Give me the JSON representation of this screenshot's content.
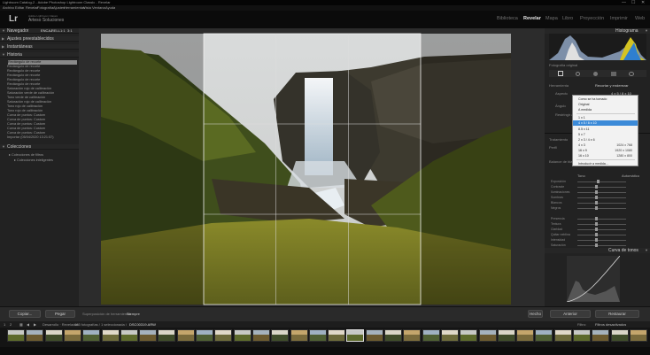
{
  "window": {
    "title": "Lightroom Catalog-2 - Adobe Photoshop Lightroom Classic - Revelar",
    "controls": [
      "—",
      "☐",
      "✕"
    ]
  },
  "menu": [
    "Archivo",
    "Editar",
    "Revelar",
    "Fotografía",
    "Ajustes",
    "Herramientas",
    "Vista",
    "Ventana",
    "Ayuda"
  ],
  "identity": {
    "logo": "Lr",
    "catalog": "Adobe Lightroom Classic",
    "name": "Arteso Soluciones"
  },
  "modules": [
    {
      "label": "Biblioteca",
      "active": false
    },
    {
      "label": "Revelar",
      "active": true
    },
    {
      "label": "Mapa",
      "active": false
    },
    {
      "label": "Libro",
      "active": false
    },
    {
      "label": "Proyección",
      "active": false
    },
    {
      "label": "Imprimir",
      "active": false
    },
    {
      "label": "Web",
      "active": false
    }
  ],
  "left_panel": {
    "navigator": {
      "title": "Navegador",
      "zoom": [
        "ENCAJ",
        "RELL",
        "1:1",
        "3:1"
      ]
    },
    "presets_title": "Ajustes preestablecidos",
    "snapshots_title": "Instantáneas",
    "history_title": "Historia",
    "history": [
      "Rectángulo de recorte",
      "Rectángulo de recorte",
      "Rectángulo de recorte",
      "Rectángulo de recorte",
      "Rectángulo de recorte",
      "Rectángulo de recorte",
      "Saturación rojo de calibración",
      "Saturación verde de calibración",
      "Tono verde de calibración",
      "Saturación rojo de calibración",
      "Tono rojo de calibración",
      "Tono rojo de calibración",
      "Curva de puntos: Custom",
      "Curva de puntos: Custom",
      "Curva de puntos: Custom",
      "Curva de puntos: Custom",
      "Curva de puntos: Custom",
      "Importar (05/04/2020 13:21:57)"
    ],
    "collections_title": "Colecciones",
    "collections": [
      "Colecciones de filtros",
      "Colecciones inteligentes"
    ],
    "copy_button": "Copiar...",
    "paste_button": "Pegar"
  },
  "toolbar": {
    "overlay_label": "Superposición de herramientas :",
    "overlay_value": "Siempre",
    "done_button": "Hecho"
  },
  "right_panel": {
    "histogram_title": "Histograma",
    "original_label": "Fotografía original",
    "tool_label": "Herramienta",
    "crop_title": "Recortar y enderezar",
    "aspect_label": "Aspecto",
    "aspect_value": "4 x 5 / 8 x 10",
    "angle_label": "Ángulo",
    "constrain_label": "Restringir a imagen",
    "treatment_label": "Tratamiento",
    "profile_label": "Perfil",
    "wb_label": "Balance de blancos",
    "tone_label": "Tono",
    "auto_label": "Automático",
    "sliders": [
      "Exposición",
      "Contraste",
      "Iluminaciones",
      "Sombras",
      "Blancos",
      "Negros",
      "Presencia",
      "Textura",
      "Claridad",
      "Quitar neblina",
      "Intensidad",
      "Saturación"
    ],
    "tone_curve_title": "Curva de tonos",
    "previous_button": "Anterior",
    "reset_button": "Restaurar"
  },
  "aspect_menu": {
    "items": [
      {
        "label": "Como se ha tomado",
        "res": ""
      },
      {
        "label": "Original",
        "res": ""
      },
      {
        "label": "A medida",
        "res": ""
      },
      {
        "label": "1 x 1",
        "res": ""
      },
      {
        "label": "4 x 5 / 8 x 10",
        "res": "",
        "selected": true
      },
      {
        "label": "8.5 x 11",
        "res": ""
      },
      {
        "label": "5 x 7",
        "res": ""
      },
      {
        "label": "2 x 3 / 4 x 6",
        "res": ""
      },
      {
        "label": "4 x 3",
        "res": "1024 x 768"
      },
      {
        "label": "16 x 9",
        "res": "1920 x 1080"
      },
      {
        "label": "16 x 10",
        "res": "1280 x 800"
      },
      {
        "label": "Introducir a medida...",
        "res": ""
      }
    ]
  },
  "filmstrip": {
    "nav": [
      "1",
      "2"
    ],
    "source": "Desarrollo · Revelados",
    "count": "465 fotografías / 1 seleccionada /",
    "filename": "DSC00319.ARW",
    "filter_label": "Filtro:",
    "filter_value": "Filtros desactivados",
    "thumb_count": 34,
    "selected_index": 18
  }
}
